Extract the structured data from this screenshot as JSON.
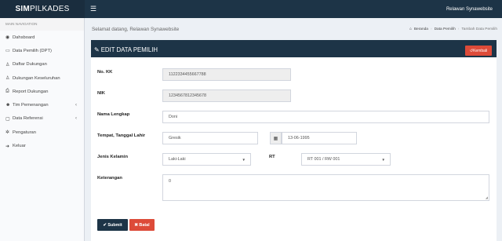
{
  "header": {
    "logo_bold": "SIM",
    "logo_rest": "PILKADES",
    "toggle_icon": "☰",
    "user": "Relawan Synawebsite"
  },
  "sidebar": {
    "heading": "MAIN NAVIGATION",
    "items": [
      {
        "label": "Dahsboard",
        "icon": "dashboard-icon",
        "glyph": "◉"
      },
      {
        "label": "Data Pemilih (DPT)",
        "icon": "file-icon",
        "glyph": "▭"
      },
      {
        "label": "Daftar Dukungan",
        "icon": "thumbs-up-icon",
        "glyph": "♙"
      },
      {
        "label": "Dukungan Keseluruhan",
        "icon": "thumbs-up-icon",
        "glyph": "♙"
      },
      {
        "label": "Report Dukungan",
        "icon": "print-icon",
        "glyph": "⎙"
      },
      {
        "label": "Tim Pemenangan",
        "icon": "users-icon",
        "glyph": "☻",
        "chevron": "‹"
      },
      {
        "label": "Data Referensi",
        "icon": "folder-icon",
        "glyph": "▢",
        "chevron": "‹"
      },
      {
        "label": "Pengaturan",
        "icon": "gear-icon",
        "glyph": "✲"
      },
      {
        "label": "Keluar",
        "icon": "sign-out-icon",
        "glyph": "➜"
      }
    ]
  },
  "content": {
    "greeting": "Selamat datang, Relawan Synawebsite",
    "breadcrumb": [
      "Beranda",
      "Data Pemilih",
      "Tambah Data Pemilih"
    ],
    "box_title": "EDIT DATA PEMILIH",
    "back_label": "Kembali",
    "form": {
      "no_kk_label": "No. KK",
      "no_kk_value": "1122334455667788",
      "nik_label": "NIK",
      "nik_value": "1234567812345678",
      "nama_label": "Nama Lengkap",
      "nama_value": "Doni",
      "ttl_label": "Tempat, Tanggal Lahir",
      "tempat_value": "Gresik",
      "tanggal_value": "13-06-1995",
      "jk_label": "Jenis Kelamin",
      "jk_value": "Laki-Laki",
      "rt_label": "RT",
      "rt_value": "RT 001 / RW 001",
      "ket_label": "Keterangan",
      "ket_value": "0"
    },
    "submit_label": "Submit",
    "batal_label": "Batal"
  },
  "colors": {
    "primary": "#1d3447",
    "danger": "#dd4b39",
    "background": "#ecf0f5"
  }
}
